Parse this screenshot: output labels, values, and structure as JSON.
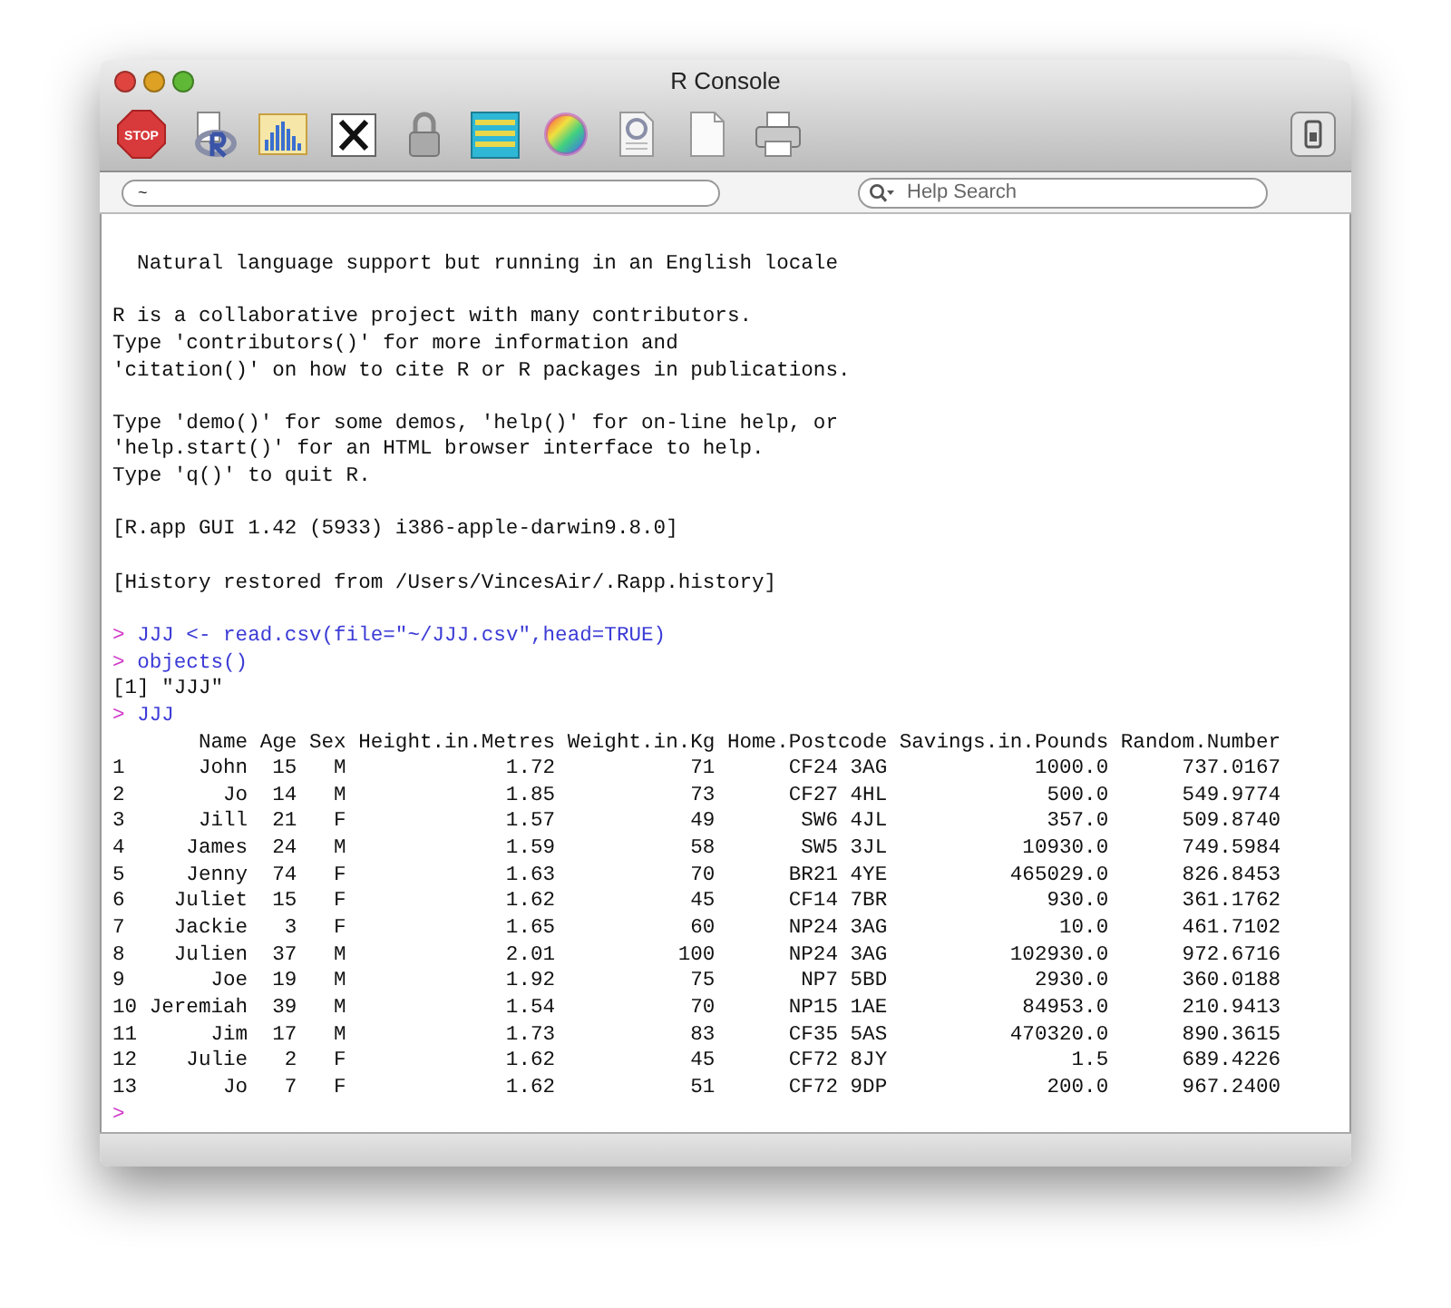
{
  "window": {
    "title": "R Console"
  },
  "toolbar": {
    "stop_label": "STOP"
  },
  "path_field": {
    "value": "~"
  },
  "help_search": {
    "placeholder": "Help Search"
  },
  "console": [
    {
      "kind": "output",
      "text": "  Natural language support but running in an English locale"
    },
    {
      "kind": "blank"
    },
    {
      "kind": "output",
      "text": "R is a collaborative project with many contributors."
    },
    {
      "kind": "output",
      "text": "Type 'contributors()' for more information and"
    },
    {
      "kind": "output",
      "text": "'citation()' on how to cite R or R packages in publications."
    },
    {
      "kind": "blank"
    },
    {
      "kind": "output",
      "text": "Type 'demo()' for some demos, 'help()' for on-line help, or"
    },
    {
      "kind": "output",
      "text": "'help.start()' for an HTML browser interface to help."
    },
    {
      "kind": "output",
      "text": "Type 'q()' to quit R."
    },
    {
      "kind": "blank"
    },
    {
      "kind": "output",
      "text": "[R.app GUI 1.42 (5933) i386-apple-darwin9.8.0]"
    },
    {
      "kind": "blank"
    },
    {
      "kind": "output",
      "text": "[History restored from /Users/VincesAir/.Rapp.history]"
    },
    {
      "kind": "blank"
    },
    {
      "kind": "input",
      "prompt": ">",
      "command": "JJJ <- read.csv(file=\"~/JJJ.csv\",head=TRUE)"
    },
    {
      "kind": "input",
      "prompt": ">",
      "command": "objects()"
    },
    {
      "kind": "output",
      "text": "[1] \"JJJ\""
    },
    {
      "kind": "input",
      "prompt": ">",
      "command": "JJJ"
    },
    {
      "kind": "output",
      "text": "       Name Age Sex Height.in.Metres Weight.in.Kg Home.Postcode Savings.in.Pounds Random.Number"
    },
    {
      "kind": "output",
      "text": "1      John  15   M             1.72           71      CF24 3AG            1000.0      737.0167"
    },
    {
      "kind": "output",
      "text": "2        Jo  14   M             1.85           73      CF27 4HL             500.0      549.9774"
    },
    {
      "kind": "output",
      "text": "3      Jill  21   F             1.57           49       SW6 4JL             357.0      509.8740"
    },
    {
      "kind": "output",
      "text": "4     James  24   M             1.59           58       SW5 3JL           10930.0      749.5984"
    },
    {
      "kind": "output",
      "text": "5     Jenny  74   F             1.63           70      BR21 4YE          465029.0      826.8453"
    },
    {
      "kind": "output",
      "text": "6    Juliet  15   F             1.62           45      CF14 7BR             930.0      361.1762"
    },
    {
      "kind": "output",
      "text": "7    Jackie   3   F             1.65           60      NP24 3AG              10.0      461.7102"
    },
    {
      "kind": "output",
      "text": "8    Julien  37   M             2.01          100      NP24 3AG          102930.0      972.6716"
    },
    {
      "kind": "output",
      "text": "9       Joe  19   M             1.92           75       NP7 5BD            2930.0      360.0188"
    },
    {
      "kind": "output",
      "text": "10 Jeremiah  39   M             1.54           70      NP15 1AE           84953.0      210.9413"
    },
    {
      "kind": "output",
      "text": "11      Jim  17   M             1.73           83      CF35 5AS          470320.0      890.3615"
    },
    {
      "kind": "output",
      "text": "12    Julie   2   F             1.62           45      CF72 8JY               1.5      689.4226"
    },
    {
      "kind": "output",
      "text": "13       Jo   7   F             1.62           51      CF72 9DP             200.0      967.2400"
    },
    {
      "kind": "input",
      "prompt": ">"
    }
  ]
}
